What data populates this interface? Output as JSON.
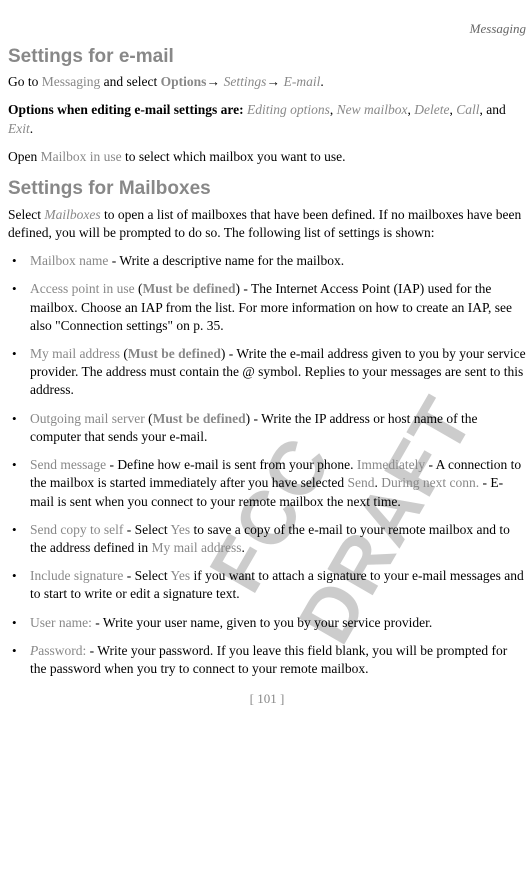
{
  "header": {
    "section": "Messaging"
  },
  "watermark": "FCC DRAFT",
  "email_settings": {
    "heading": "Settings for e-mail",
    "goto_prefix": "Go to ",
    "messaging": "Messaging",
    "and_select": " and select ",
    "options": "Options",
    "arrow1": "→ ",
    "settings": "Settings",
    "arrow2": "→ ",
    "email": "E-mail",
    "period1": ".",
    "options_when": "Options when editing e-mail settings are: ",
    "opt1": "Editing options",
    "c1": ", ",
    "opt2": "New mailbox",
    "c2": ", ",
    "opt3": "Delete",
    "c3": ", ",
    "opt4": "Call",
    "c4": ", and ",
    "opt5": "Exit",
    "period2": ".",
    "open_prefix": "Open ",
    "mailbox_in_use": "Mailbox in use",
    "open_suffix": " to select which mailbox you want to use."
  },
  "mailbox_settings": {
    "heading": "Settings for Mailboxes",
    "intro_select": "Select ",
    "intro_mailboxes": "Mailboxes",
    "intro_rest": " to open a list of mailboxes that have been defined. If no mailboxes have been defined, you will be prompted to do so. The following list of settings is shown:",
    "b1": {
      "label": "Mailbox name",
      "text": " - Write a descriptive name for the mailbox."
    },
    "b2": {
      "label": "Access point in use",
      "paren_open": " (",
      "must": "Must be defined",
      "paren_close": ")",
      "text": " - The Internet Access Point (IAP) used for the mailbox. Choose an IAP from the list. For more information on how to create an IAP, see also \"Connection settings\" on p. 35."
    },
    "b3": {
      "label": "My mail address",
      "paren_open": " (",
      "must": "Must be defined",
      "paren_close": ")",
      "text": " - Write the e-mail address given to you by your service provider. The address must contain the @ symbol. Replies to your messages are sent to this address."
    },
    "b4": {
      "label": "Outgoing mail server",
      "paren_open": " (",
      "must": "Must be defined",
      "paren_close": ")",
      "text": " - Write the IP address or host name of the computer that sends your e-mail."
    },
    "b5": {
      "label": "Send message",
      "t1": " - Define how e-mail is sent from your phone. ",
      "imm": "Immediately",
      "t2": " - A connection to the mailbox is started immediately after you have selected ",
      "send": "Send",
      "t3": ". ",
      "during": "During next conn.",
      "t4": " - E-mail is sent when you connect to your remote mailbox the next time."
    },
    "b6": {
      "label": "Send copy to self",
      "t1": " - Select ",
      "yes": "Yes",
      "t2": " to save a copy of the e-mail to your remote mailbox and to the address defined in ",
      "my_addr": "My mail address",
      "t3": "."
    },
    "b7": {
      "label": "Include signature",
      "t1": " - Select ",
      "yes": "Yes",
      "t2": " if you want to attach a signature to your e-mail messages and to start to write or edit a signature text."
    },
    "b8": {
      "label": "User name:",
      "text": " - Write your user name, given to you by your service provider."
    },
    "b9": {
      "label_p": "P",
      "label_rest": "assword:",
      "text": " - Write your password. If you leave this field blank, you will be prompted for the password when you try to connect to your remote mailbox."
    }
  },
  "page_number": "[ 101 ]"
}
